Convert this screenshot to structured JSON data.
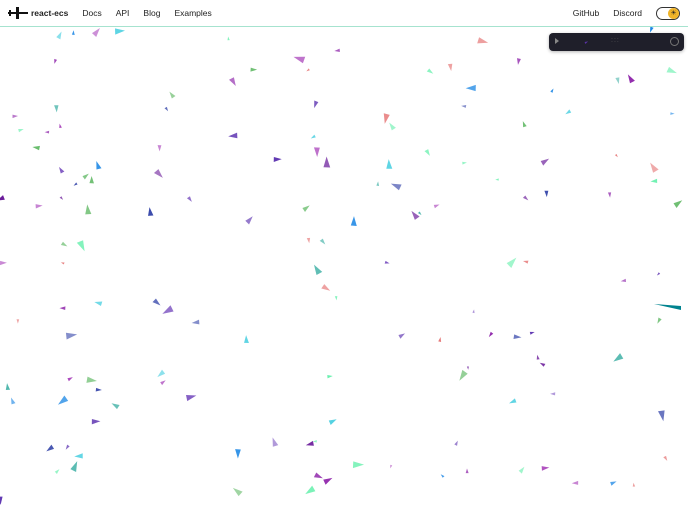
{
  "nav": {
    "brand": "react-ecs",
    "links": [
      "Docs",
      "API",
      "Blog",
      "Examples"
    ],
    "right_links": [
      "GitHub",
      "Discord"
    ],
    "theme_toggle_icon": "sun-icon"
  },
  "panel": {
    "play_icon": "play-icon",
    "handle": ":::",
    "settings_icon": "gear-icon"
  },
  "colors": {
    "accent_border": "#a6e3cf",
    "panel_bg": "#1f1f2a"
  }
}
